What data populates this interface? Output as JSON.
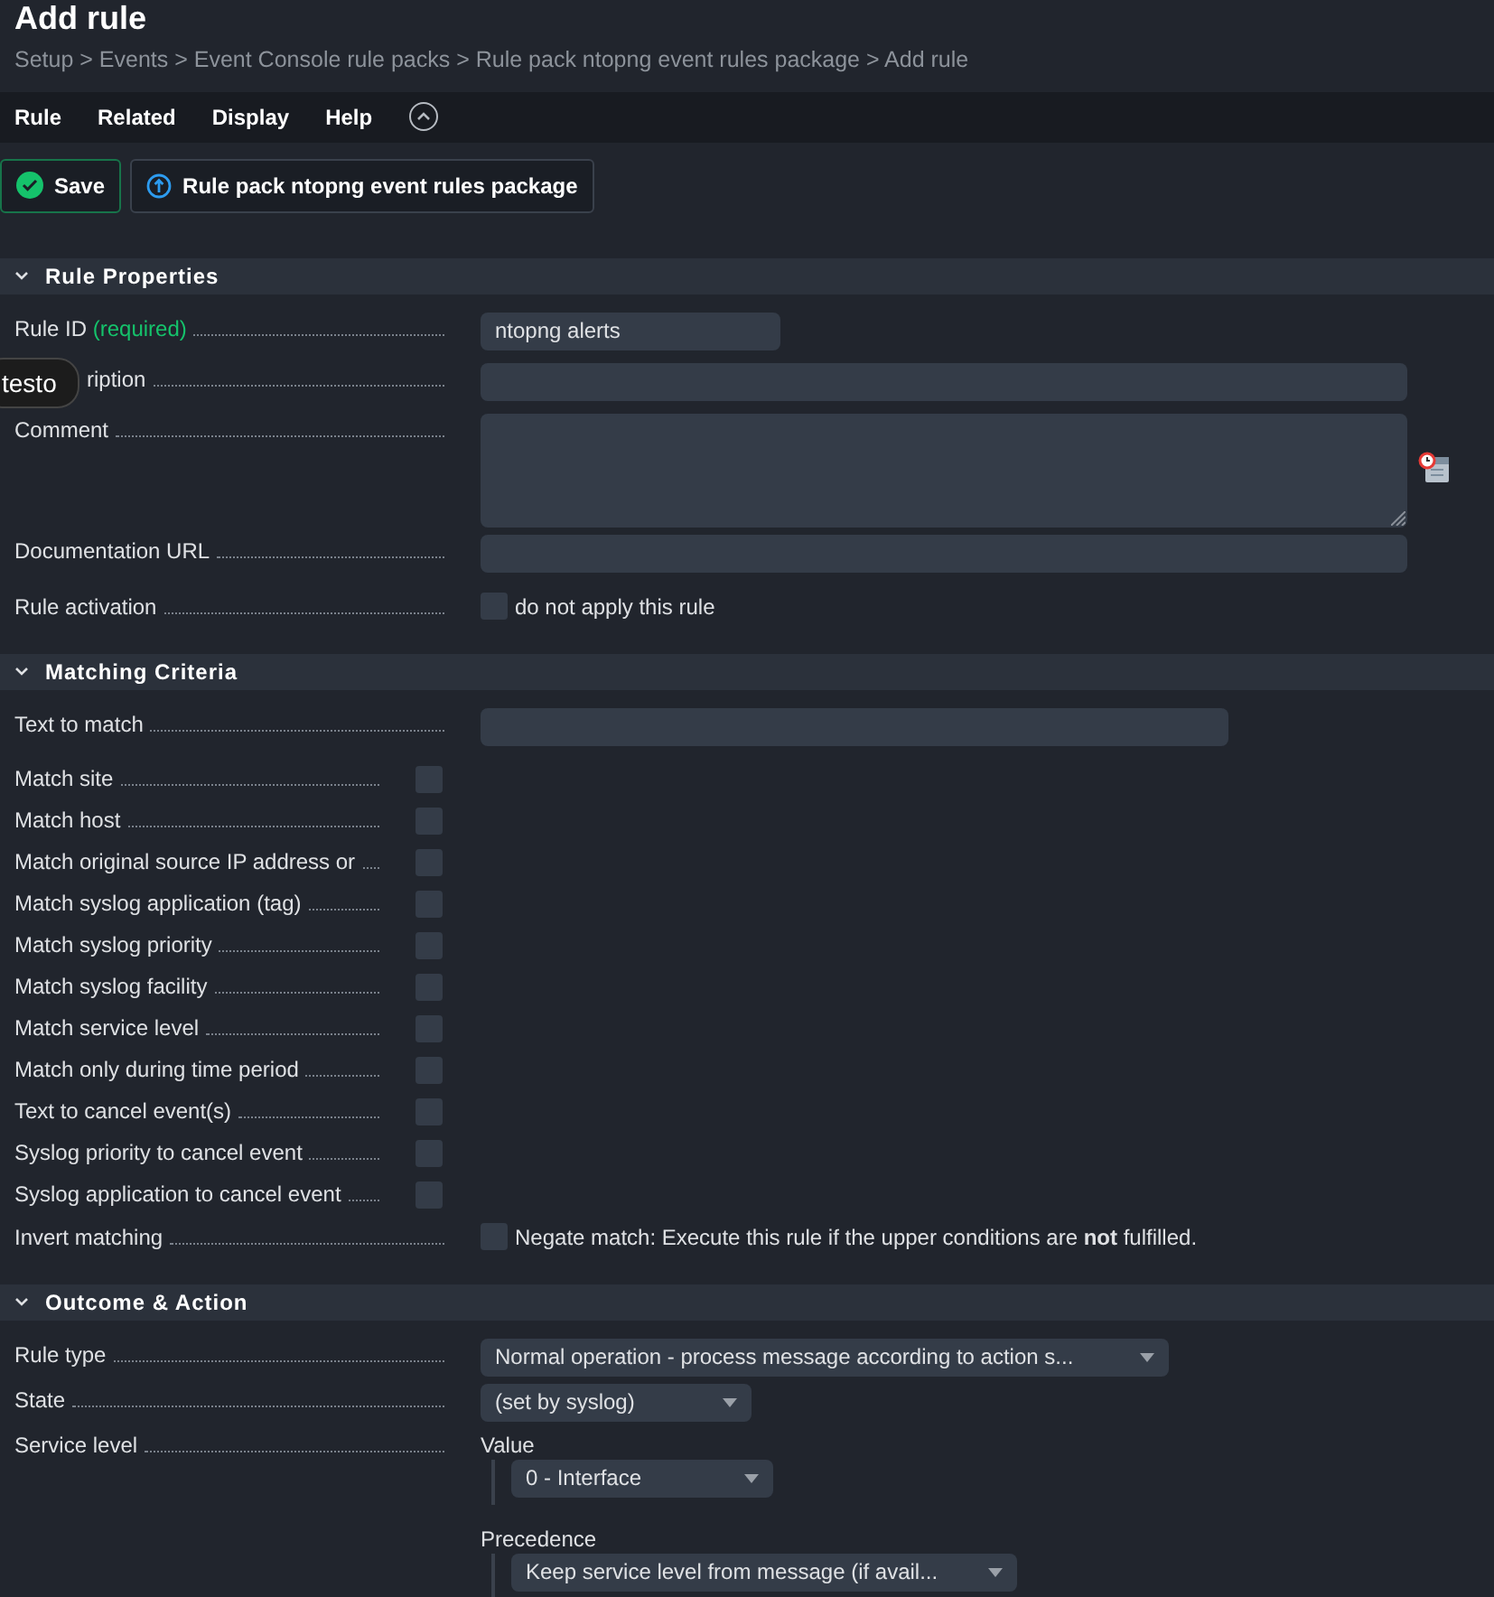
{
  "title": "Add rule",
  "breadcrumb": "Setup > Events > Event Console rule packs > Rule pack ntopng event rules package > Add rule",
  "menu": [
    "Rule",
    "Related",
    "Display",
    "Help"
  ],
  "buttons": [
    {
      "kind": "save",
      "label": "Save"
    },
    {
      "kind": "back",
      "label": "Rule pack ntopng event rules package"
    }
  ],
  "tooltip": "testo",
  "sections": [
    {
      "title": "Rule Properties",
      "expanded": true,
      "rows": [
        {
          "kind": "input",
          "label": "Rule ID",
          "required": "(required)",
          "value": "ntopng alerts"
        },
        {
          "kind": "input",
          "label": "ription"
        },
        {
          "kind": "textarea",
          "label": "Comment"
        },
        {
          "kind": "input",
          "label": "Documentation URL"
        },
        {
          "kind": "checkbox",
          "label": "Rule activation",
          "text": "do not apply this rule",
          "checked": false
        }
      ]
    },
    {
      "title": "Matching Criteria",
      "expanded": true,
      "rows": [
        {
          "kind": "input",
          "label": "Text to match"
        },
        {
          "kind": "toggle",
          "label": "Match site",
          "checked": false
        },
        {
          "kind": "toggle",
          "label": "Match host",
          "checked": false
        },
        {
          "kind": "toggle",
          "label": "Match original source IP address or",
          "checked": false
        },
        {
          "kind": "toggle",
          "label": "Match syslog application (tag)",
          "checked": false
        },
        {
          "kind": "toggle",
          "label": "Match syslog priority",
          "checked": false
        },
        {
          "kind": "toggle",
          "label": "Match syslog facility",
          "checked": false
        },
        {
          "kind": "toggle",
          "label": "Match service level",
          "checked": false
        },
        {
          "kind": "toggle",
          "label": "Match only during time period",
          "checked": false
        },
        {
          "kind": "toggle",
          "label": "Text to cancel event(s)",
          "checked": false
        },
        {
          "kind": "toggle",
          "label": "Syslog priority to cancel event",
          "checked": false
        },
        {
          "kind": "toggle",
          "label": "Syslog application to cancel event",
          "checked": false
        },
        {
          "kind": "checkbox",
          "label": "Invert matching",
          "text": "Negate match: Execute this rule if the upper conditions are **not** fulfilled.",
          "checked": false
        }
      ]
    },
    {
      "title": "Outcome & Action",
      "expanded": true,
      "rows": [
        {
          "kind": "select",
          "label": "Rule type",
          "value": "Normal operation - process message according to action s..."
        },
        {
          "kind": "select",
          "label": "State",
          "value": "(set by syslog)"
        },
        {
          "kind": "group",
          "label": "Service level",
          "items": [
            {
              "label": "Value",
              "value": "0 - Interface"
            },
            {
              "label": "Precedence",
              "value": "Keep service level from message (if avail..."
            }
          ]
        }
      ]
    }
  ]
}
